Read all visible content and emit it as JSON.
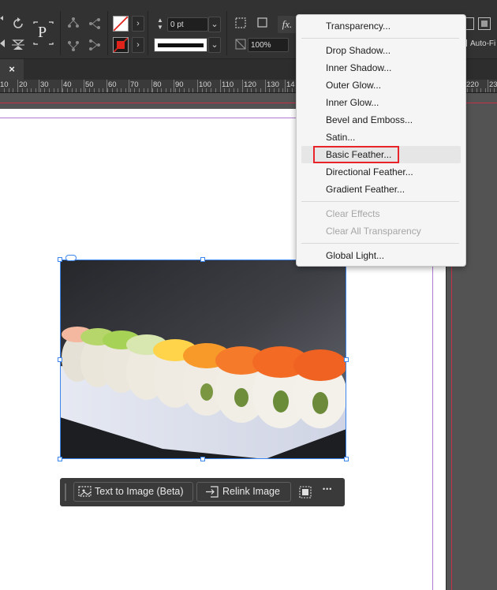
{
  "control_bar": {
    "text_frame_glyph": "P",
    "stroke_weight": "0 pt",
    "opacity": "100%",
    "fx_label": "fx.",
    "auto_fit_label": "Auto-Fi",
    "colors": {
      "fill_stroke_red": "#e0241b",
      "selection_blue": "#3d85ee"
    }
  },
  "tab": {
    "close_glyph": "×"
  },
  "ruler": {
    "labels": [
      "10",
      "20",
      "30",
      "40",
      "50",
      "60",
      "70",
      "80",
      "90",
      "100",
      "110",
      "120",
      "130",
      "14",
      "220",
      "23"
    ]
  },
  "fx_menu": {
    "items": [
      {
        "label": "Transparency...",
        "enabled": true
      },
      {
        "label": "Drop Shadow...",
        "enabled": true
      },
      {
        "label": "Inner Shadow...",
        "enabled": true
      },
      {
        "label": "Outer Glow...",
        "enabled": true
      },
      {
        "label": "Inner Glow...",
        "enabled": true
      },
      {
        "label": "Bevel and Emboss...",
        "enabled": true
      },
      {
        "label": "Satin...",
        "enabled": true
      },
      {
        "label": "Basic Feather...",
        "enabled": true,
        "highlighted": true
      },
      {
        "label": "Directional Feather...",
        "enabled": true
      },
      {
        "label": "Gradient Feather...",
        "enabled": true
      },
      {
        "label": "Clear Effects",
        "enabled": false
      },
      {
        "label": "Clear All Transparency",
        "enabled": false
      },
      {
        "label": "Global Light...",
        "enabled": true
      }
    ],
    "highlight_color": "#e8232a"
  },
  "taskbar": {
    "text_to_image": "Text to Image (Beta)",
    "relink_image": "Relink Image",
    "more_glyph": "•••"
  },
  "icons": {
    "rotate": "rotate-ccw-icon",
    "flip": "flip-icon",
    "fx": "fx-icon",
    "frame_fit": "frame-fit-icon",
    "image_gen": "image-generate-icon",
    "relink": "relink-icon"
  }
}
